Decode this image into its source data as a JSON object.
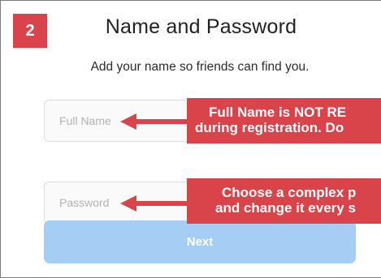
{
  "step": {
    "number": "2"
  },
  "header": {
    "title": "Name and Password",
    "subtitle": "Add your name so friends can find you."
  },
  "form": {
    "full_name": {
      "placeholder": "Full Name",
      "value": ""
    },
    "password": {
      "placeholder": "Password",
      "value": ""
    },
    "next_label": "Next"
  },
  "callouts": {
    "full_name": {
      "line1": "Full Name is NOT RE",
      "line2": "during registration. Do"
    },
    "password": {
      "line1": "Choose a complex p",
      "line2": "and change it every s"
    }
  },
  "colors": {
    "accent_red": "#d9444a",
    "button_disabled_blue": "#a6cef4",
    "field_border": "#dcdcdc",
    "placeholder_gray": "#b2b2b2"
  },
  "icons": {
    "callout_pointer": "left-arrow-icon"
  }
}
